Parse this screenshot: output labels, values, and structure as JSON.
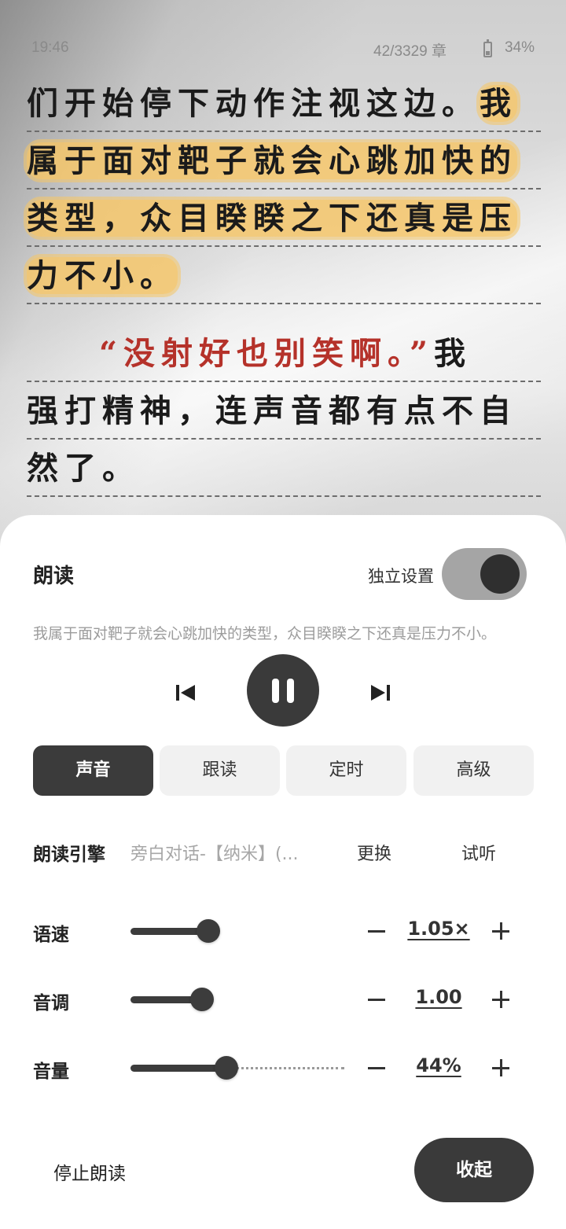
{
  "status": {
    "time": "19:46",
    "chapter": "42/3329 章",
    "battery": "34%"
  },
  "book": {
    "line1_plain": "们开始停下动作注视这边。",
    "line1_hl": "我",
    "line2_hl": "属于面对靶子就会心跳加快的",
    "line3_hl": "类型，众目睽睽之下还真是压",
    "line4_hl": "力不小。",
    "line5_quote": "“没射好也别笑啊。”",
    "line5_tail": "我",
    "line6": "强打精神，连声音都有点不自",
    "line7": "然了。"
  },
  "sheet": {
    "title": "朗读",
    "independent_label": "独立设置",
    "independent_on": true,
    "current_text": "我属于面对靶子就会心跳加快的类型，众目睽睽之下还真是压力不小。",
    "tabs": [
      {
        "label": "声音",
        "active": true
      },
      {
        "label": "跟读",
        "active": false
      },
      {
        "label": "定时",
        "active": false
      },
      {
        "label": "高级",
        "active": false
      }
    ],
    "engine": {
      "label": "朗读引擎",
      "value": "旁白对话-【纳米】(...",
      "change": "更换",
      "preview": "试听"
    },
    "speed": {
      "label": "语速",
      "value": "1.05×",
      "level": 0.26
    },
    "pitch": {
      "label": "音调",
      "value": "1.00",
      "level": 0.24
    },
    "volume": {
      "label": "音量",
      "value": "44%",
      "level": 0.44
    },
    "stop_label": "停止朗读",
    "collapse_label": "收起"
  },
  "colors": {
    "highlight": "#f6c666",
    "quote": "#b5322a",
    "dark": "#3a3a3a"
  }
}
